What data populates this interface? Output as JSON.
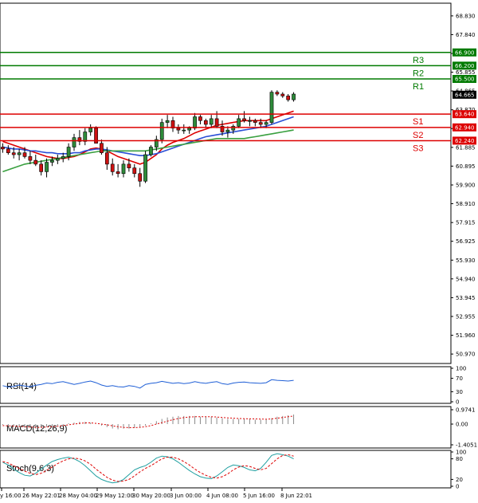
{
  "chart_data": {
    "type": "candlestick",
    "price_axis": {
      "ticks": [
        "68.830",
        "67.840",
        "66.845",
        "65.855",
        "64.865",
        "63.870",
        "62.880",
        "61.885",
        "60.895",
        "59.900",
        "58.910",
        "57.915",
        "56.925",
        "55.930",
        "54.940",
        "53.945",
        "52.955",
        "51.960",
        "50.970"
      ],
      "ylim": [
        50.47,
        69.5
      ]
    },
    "time_axis": {
      "ticks": [
        "y 16:00",
        "26 May 22:01",
        "28 May 04:00",
        "29 May 12:00",
        "30 May 20:00",
        "3 Jun 00:00",
        "4 Jun 08:00",
        "5 Jun 16:00",
        "8 Jun 22:01"
      ]
    },
    "current_price": "64.665",
    "levels": [
      {
        "name": "R3",
        "value": 66.9,
        "label": "66.900",
        "color": "#007a00"
      },
      {
        "name": "R2",
        "value": 66.2,
        "label": "66.200",
        "color": "#007a00"
      },
      {
        "name": "R1",
        "value": 65.5,
        "label": "65.500",
        "color": "#007a00"
      },
      {
        "name": "S1",
        "value": 63.64,
        "label": "63.640",
        "color": "#dd0000"
      },
      {
        "name": "S2",
        "value": 62.94,
        "label": "62.940",
        "color": "#dd0000"
      },
      {
        "name": "S3",
        "value": 62.24,
        "label": "62.240",
        "color": "#dd0000"
      }
    ],
    "candles": [
      [
        61.9,
        62.1,
        61.6,
        61.8
      ],
      [
        61.8,
        62.0,
        61.5,
        61.6
      ],
      [
        61.6,
        61.9,
        61.3,
        61.5
      ],
      [
        61.5,
        61.8,
        61.2,
        61.6
      ],
      [
        61.6,
        61.9,
        61.3,
        61.4
      ],
      [
        61.4,
        61.7,
        61.0,
        61.2
      ],
      [
        61.2,
        61.5,
        60.9,
        61.0
      ],
      [
        61.0,
        61.2,
        60.4,
        60.6
      ],
      [
        60.6,
        61.3,
        60.3,
        61.1
      ],
      [
        61.1,
        61.4,
        60.9,
        61.2
      ],
      [
        61.2,
        61.5,
        61.0,
        61.3
      ],
      [
        61.3,
        61.6,
        61.1,
        61.4
      ],
      [
        61.4,
        62.1,
        61.2,
        61.9
      ],
      [
        61.9,
        62.6,
        61.7,
        62.4
      ],
      [
        62.4,
        62.8,
        62.0,
        62.2
      ],
      [
        62.2,
        62.9,
        62.0,
        62.7
      ],
      [
        62.7,
        63.1,
        62.5,
        62.9
      ],
      [
        62.9,
        63.0,
        62.2,
        62.1
      ],
      [
        62.1,
        62.3,
        61.5,
        61.6
      ],
      [
        61.6,
        61.9,
        60.7,
        61.0
      ],
      [
        61.0,
        61.3,
        60.4,
        60.6
      ],
      [
        60.6,
        61.0,
        60.3,
        60.5
      ],
      [
        60.5,
        61.2,
        60.3,
        61.0
      ],
      [
        61.0,
        61.3,
        60.6,
        60.8
      ],
      [
        60.8,
        61.0,
        60.3,
        60.5
      ],
      [
        60.5,
        60.8,
        59.8,
        60.1
      ],
      [
        60.1,
        61.7,
        60.0,
        61.5
      ],
      [
        61.5,
        62.0,
        61.4,
        61.9
      ],
      [
        61.9,
        62.5,
        61.7,
        62.3
      ],
      [
        62.3,
        63.4,
        62.1,
        63.2
      ],
      [
        63.2,
        63.6,
        62.9,
        63.3
      ],
      [
        63.3,
        63.5,
        62.7,
        62.9
      ],
      [
        62.9,
        63.1,
        62.6,
        62.8
      ],
      [
        62.8,
        63.1,
        62.6,
        62.8
      ],
      [
        62.8,
        63.0,
        62.6,
        62.9
      ],
      [
        62.9,
        63.7,
        62.8,
        63.5
      ],
      [
        63.5,
        63.6,
        63.1,
        63.3
      ],
      [
        63.3,
        63.4,
        62.9,
        63.1
      ],
      [
        63.1,
        63.6,
        62.9,
        63.4
      ],
      [
        63.4,
        63.8,
        62.9,
        63.0
      ],
      [
        63.0,
        63.3,
        62.5,
        62.7
      ],
      [
        62.7,
        63.0,
        62.4,
        62.8
      ],
      [
        62.8,
        63.1,
        62.6,
        63.0
      ],
      [
        63.0,
        63.6,
        62.9,
        63.4
      ],
      [
        63.4,
        63.8,
        63.2,
        63.3
      ],
      [
        63.3,
        63.5,
        63.0,
        63.3
      ],
      [
        63.3,
        63.4,
        63.0,
        63.2
      ],
      [
        63.2,
        63.4,
        62.9,
        63.1
      ],
      [
        63.1,
        63.3,
        62.9,
        63.2
      ],
      [
        63.2,
        64.9,
        63.1,
        64.8
      ],
      [
        64.8,
        64.9,
        64.6,
        64.7
      ],
      [
        64.7,
        64.8,
        64.5,
        64.6
      ],
      [
        64.6,
        64.7,
        64.3,
        64.4
      ],
      [
        64.4,
        64.8,
        64.3,
        64.7
      ]
    ],
    "ma_series": [
      {
        "color": "#dd0000",
        "values": [
          62.2,
          62.1,
          62.0,
          61.9,
          61.8,
          61.7,
          61.6,
          61.5,
          61.4,
          61.35,
          61.3,
          61.3,
          61.35,
          61.4,
          61.5,
          61.65,
          61.8,
          61.85,
          61.8,
          61.7,
          61.55,
          61.4,
          61.3,
          61.2,
          61.1,
          61.0,
          61.1,
          61.3,
          61.5,
          61.8,
          62.0,
          62.15,
          62.25,
          62.35,
          62.5,
          62.65,
          62.75,
          62.85,
          62.95,
          63.05,
          63.1,
          63.15,
          63.2,
          63.25,
          63.3,
          63.3,
          63.3,
          63.3,
          63.3,
          63.4,
          63.5,
          63.6,
          63.7,
          63.8
        ]
      },
      {
        "color": "#2a4fd6",
        "values": [
          61.9,
          61.85,
          61.8,
          61.8,
          61.75,
          61.7,
          61.7,
          61.65,
          61.6,
          61.6,
          61.55,
          61.55,
          61.55,
          61.6,
          61.6,
          61.7,
          61.75,
          61.8,
          61.8,
          61.75,
          61.7,
          61.65,
          61.6,
          61.55,
          61.5,
          61.45,
          61.45,
          61.5,
          61.55,
          61.65,
          61.75,
          61.85,
          61.95,
          62.05,
          62.15,
          62.25,
          62.35,
          62.45,
          62.5,
          62.55,
          62.6,
          62.65,
          62.7,
          62.75,
          62.8,
          62.85,
          62.9,
          62.95,
          63.0,
          63.1,
          63.2,
          63.3,
          63.4,
          63.5
        ]
      },
      {
        "color": "#3aa040",
        "values": [
          60.6,
          60.7,
          60.8,
          60.9,
          61.0,
          61.05,
          61.1,
          61.15,
          61.2,
          61.25,
          61.3,
          61.35,
          61.4,
          61.45,
          61.5,
          61.55,
          61.6,
          61.65,
          61.7,
          61.7,
          61.7,
          61.7,
          61.7,
          61.7,
          61.7,
          61.7,
          61.7,
          61.75,
          61.8,
          61.85,
          61.9,
          61.95,
          62.0,
          62.05,
          62.1,
          62.15,
          62.2,
          62.25,
          62.3,
          62.35,
          62.35,
          62.35,
          62.35,
          62.35,
          62.35,
          62.4,
          62.45,
          62.5,
          62.55,
          62.6,
          62.65,
          62.7,
          62.75,
          62.8
        ]
      }
    ],
    "indicators": [
      {
        "name": "RSI(14)",
        "ticks": [
          "100",
          "70",
          "30",
          "0"
        ],
        "ylim": [
          0,
          100
        ],
        "line_color": "#1f5fd6",
        "values": [
          48,
          44,
          46,
          50,
          47,
          45,
          49,
          52,
          56,
          54,
          58,
          60,
          56,
          52,
          55,
          59,
          62,
          57,
          50,
          46,
          48,
          45,
          44,
          48,
          46,
          41,
          52,
          55,
          57,
          61,
          58,
          55,
          57,
          54,
          56,
          60,
          57,
          55,
          58,
          60,
          54,
          52,
          56,
          58,
          59,
          57,
          56,
          55,
          57,
          66,
          64,
          63,
          62,
          64
        ]
      },
      {
        "name": "MACD(12,26,9)",
        "ticks": [
          "0.9741",
          "0.00",
          "-1.4051"
        ],
        "ylim": [
          -1.4051,
          0.9741
        ],
        "line_color": "#dd0000",
        "histogram": [
          -0.05,
          -0.1,
          -0.15,
          -0.2,
          -0.25,
          -0.25,
          -0.3,
          -0.25,
          -0.2,
          -0.15,
          -0.1,
          -0.05,
          0.05,
          0.1,
          0.15,
          0.15,
          0.1,
          0.0,
          -0.1,
          -0.2,
          -0.3,
          -0.35,
          -0.3,
          -0.3,
          -0.25,
          -0.2,
          -0.1,
          0.05,
          0.2,
          0.35,
          0.45,
          0.5,
          0.55,
          0.55,
          0.55,
          0.55,
          0.5,
          0.5,
          0.5,
          0.45,
          0.4,
          0.35,
          0.35,
          0.35,
          0.35,
          0.35,
          0.3,
          0.3,
          0.3,
          0.4,
          0.5,
          0.55,
          0.6,
          0.65
        ],
        "signal": [
          -0.1,
          -0.12,
          -0.14,
          -0.16,
          -0.18,
          -0.2,
          -0.22,
          -0.22,
          -0.2,
          -0.18,
          -0.15,
          -0.1,
          -0.05,
          0.0,
          0.05,
          0.08,
          0.08,
          0.05,
          0.0,
          -0.05,
          -0.12,
          -0.18,
          -0.22,
          -0.24,
          -0.24,
          -0.22,
          -0.18,
          -0.1,
          0.0,
          0.1,
          0.2,
          0.3,
          0.38,
          0.44,
          0.48,
          0.5,
          0.5,
          0.5,
          0.5,
          0.48,
          0.45,
          0.42,
          0.4,
          0.38,
          0.37,
          0.36,
          0.35,
          0.34,
          0.33,
          0.35,
          0.4,
          0.45,
          0.5,
          0.55
        ]
      },
      {
        "name": "Stoch(9,6,3)",
        "ticks": [
          "100",
          "80",
          "20",
          "0"
        ],
        "ylim": [
          0,
          100
        ],
        "line_color": "#1f9fa0",
        "signal_color": "#dd0000",
        "k": [
          70,
          62,
          50,
          40,
          32,
          30,
          38,
          50,
          62,
          72,
          78,
          82,
          85,
          80,
          72,
          60,
          45,
          30,
          20,
          14,
          10,
          12,
          20,
          34,
          48,
          55,
          60,
          70,
          82,
          88,
          86,
          80,
          70,
          58,
          46,
          36,
          28,
          24,
          22,
          30,
          42,
          55,
          62,
          60,
          55,
          48,
          45,
          52,
          70,
          90,
          95,
          92,
          88,
          80
        ],
        "d": [
          72,
          68,
          60,
          52,
          44,
          38,
          34,
          38,
          46,
          56,
          66,
          74,
          80,
          82,
          80,
          74,
          64,
          50,
          38,
          26,
          18,
          14,
          15,
          20,
          30,
          42,
          52,
          60,
          70,
          80,
          85,
          85,
          80,
          72,
          62,
          50,
          40,
          32,
          26,
          24,
          28,
          36,
          48,
          56,
          60,
          58,
          52,
          48,
          52,
          66,
          80,
          90,
          92,
          88
        ]
      }
    ]
  }
}
